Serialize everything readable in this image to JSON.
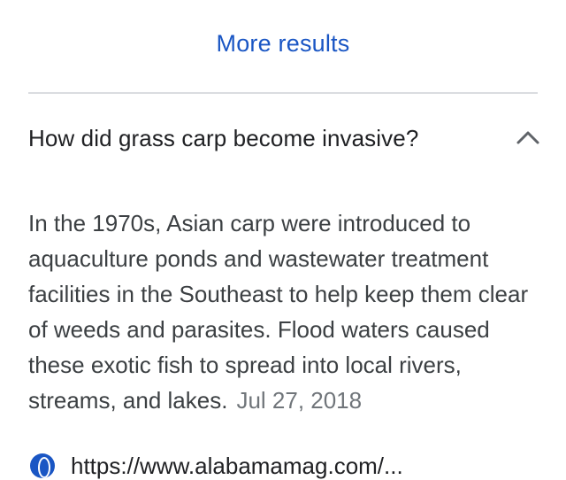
{
  "more_results": {
    "label": "More results"
  },
  "faq": {
    "question": "How did grass carp become invasive?",
    "expanded_icon": "chevron-up-icon",
    "answer": "In the 1970s, Asian carp were introduced to aquaculture ponds and wastewater treatment facilities in the Southeast to help keep them clear of weeds and parasites. Flood waters caused these exotic fish to spread into local rivers, streams, and lakes.",
    "date": "Jul 27, 2018",
    "source": {
      "icon": "globe-icon",
      "url": "https://www.alabamamag.com/..."
    }
  },
  "colors": {
    "link": "#1a56c4",
    "text": "#3c4043",
    "divider": "#dadce0",
    "date": "#70757a"
  }
}
